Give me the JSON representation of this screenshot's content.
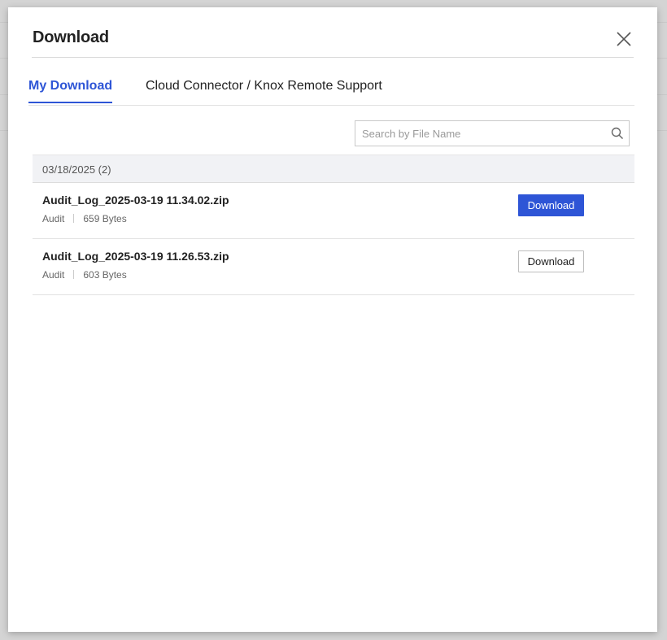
{
  "dialog": {
    "title": "Download",
    "close_icon": "close-icon"
  },
  "tabs": [
    {
      "label": "My Download",
      "active": true
    },
    {
      "label": "Cloud Connector / Knox Remote Support",
      "active": false
    }
  ],
  "search": {
    "placeholder": "Search by File Name",
    "value": "",
    "icon": "search-icon"
  },
  "groups": [
    {
      "date_label": "03/18/2025 (2)",
      "files": [
        {
          "name": "Audit_Log_2025-03-19 11.34.02.zip",
          "category": "Audit",
          "size": "659 Bytes",
          "button_label": "Download",
          "button_style": "primary"
        },
        {
          "name": "Audit_Log_2025-03-19 11.26.53.zip",
          "category": "Audit",
          "size": "603 Bytes",
          "button_label": "Download",
          "button_style": "secondary"
        }
      ]
    }
  ],
  "colors": {
    "accent": "#2e55d6",
    "group_header_bg": "#f1f2f5",
    "overlay": "#d4d4d4"
  }
}
